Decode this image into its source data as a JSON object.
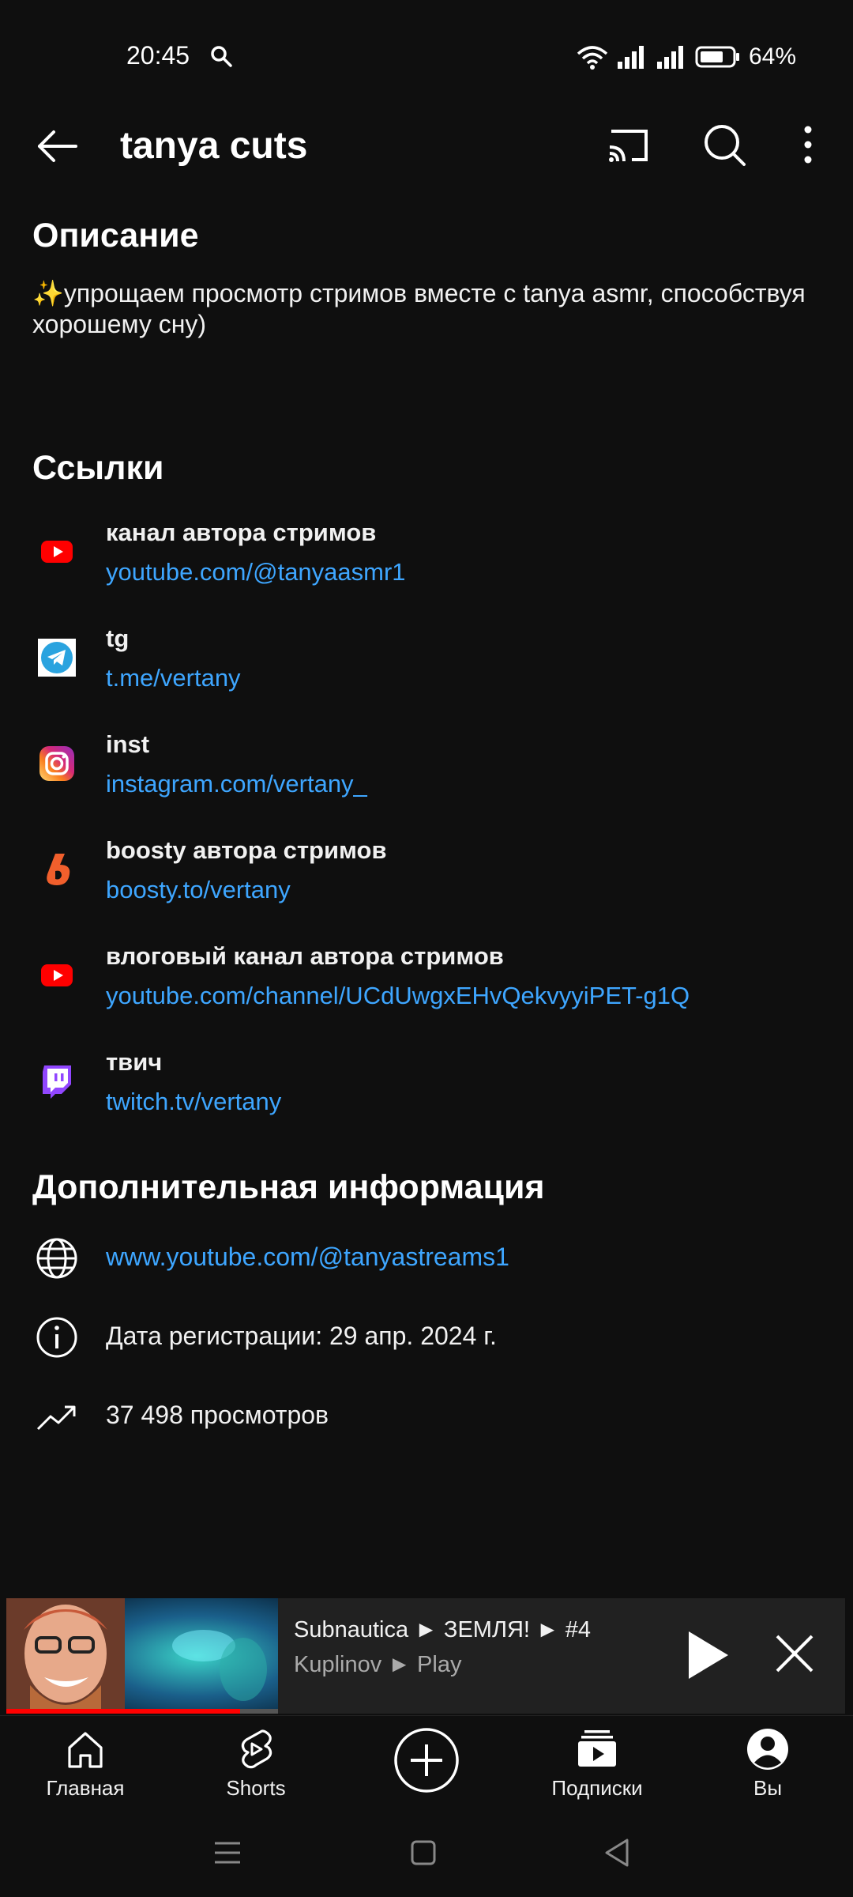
{
  "status_bar": {
    "time": "20:45",
    "battery": "64%"
  },
  "header": {
    "title": "tanya cuts"
  },
  "description": {
    "heading": "Описание",
    "text": "✨упрощаем просмотр стримов вместе с tanya asmr, способствуя хорошему сну)"
  },
  "links": {
    "heading": "Ссылки",
    "items": [
      {
        "title": "канал автора стримов",
        "url": "youtube.com/@tanyaasmr1",
        "icon": "youtube-icon"
      },
      {
        "title": "tg",
        "url": "t.me/vertany",
        "icon": "telegram-icon"
      },
      {
        "title": "inst",
        "url": "instagram.com/vertany_",
        "icon": "instagram-icon"
      },
      {
        "title": "boosty автора стримов",
        "url": "boosty.to/vertany",
        "icon": "boosty-icon"
      },
      {
        "title": "влоговый канал автора стримов",
        "url": "youtube.com/channel/UCdUwgxEHvQekvyyiPET-g1Q",
        "icon": "youtube-icon"
      },
      {
        "title": "твич",
        "url": "twitch.tv/vertany",
        "icon": "twitch-icon"
      }
    ]
  },
  "additional": {
    "heading": "Дополнительная информация",
    "website": "www.youtube.com/@tanyastreams1",
    "joined": "Дата регистрации: 29 апр. 2024 г.",
    "views": "37 498 просмотров"
  },
  "mini_player": {
    "title": "Subnautica ► ЗЕМЛЯ! ► #4",
    "channel": "Kuplinov ► Play",
    "progress": 0.86
  },
  "bottom_nav": {
    "home": "Главная",
    "shorts": "Shorts",
    "subscriptions": "Подписки",
    "you": "Вы"
  },
  "colors": {
    "link": "#3ea6ff",
    "background": "#0f0f0f",
    "progress": "#ff0000"
  }
}
